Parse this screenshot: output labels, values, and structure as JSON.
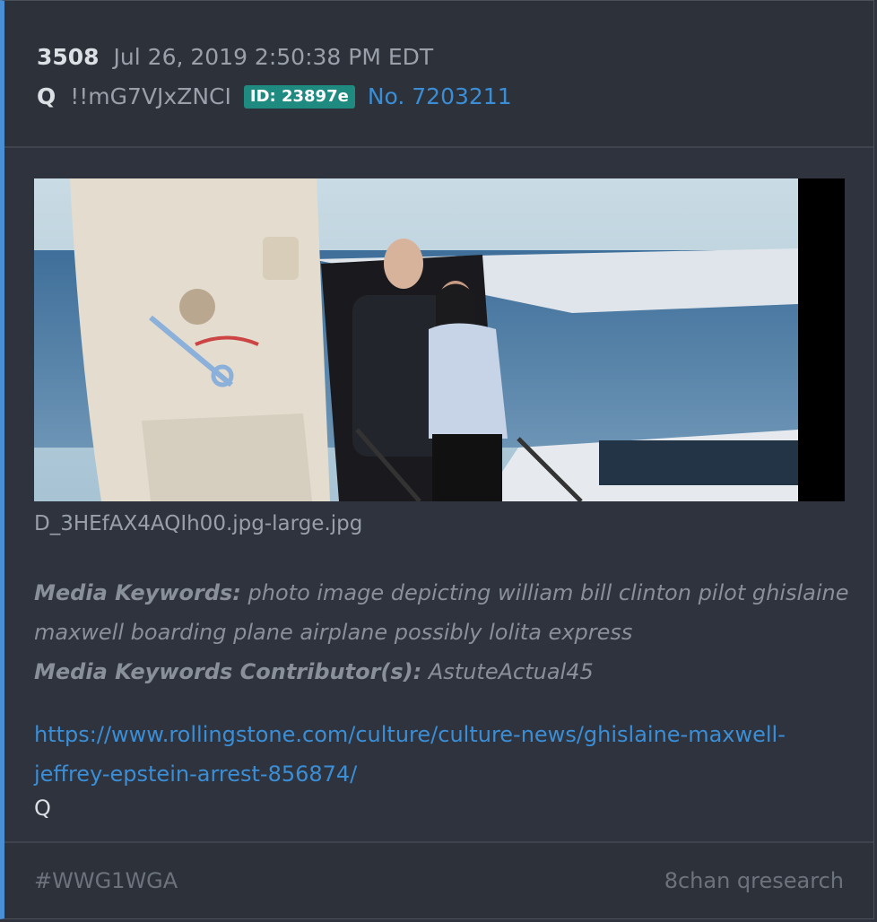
{
  "post": {
    "number": "3508",
    "date": "Jul 26, 2019 2:50:38 PM EDT",
    "author": "Q",
    "tripcode": "!!mG7VJxZNCI",
    "id_badge": "ID: 23897e",
    "post_no": "No. 7203211"
  },
  "media": {
    "filename": "D_3HEfAX4AQIh00.jpg-large.jpg",
    "keywords_label": "Media Keywords:",
    "keywords": "photo image depicting william bill clinton pilot ghislaine maxwell boarding plane airplane possibly lolita express",
    "contrib_label": "Media Keywords Contributor(s):",
    "contributor": "AstuteActual45"
  },
  "body": {
    "link": "https://www.rollingstone.com/culture/culture-news/ghislaine-maxwell-jeffrey-epstein-arrest-856874/",
    "signature": "Q"
  },
  "footer": {
    "hashtag": "#WWG1WGA",
    "source": "8chan qresearch"
  },
  "colors": {
    "accent": "#4a8fd6",
    "link": "#3b8ed6",
    "badge": "#1f8a80"
  }
}
